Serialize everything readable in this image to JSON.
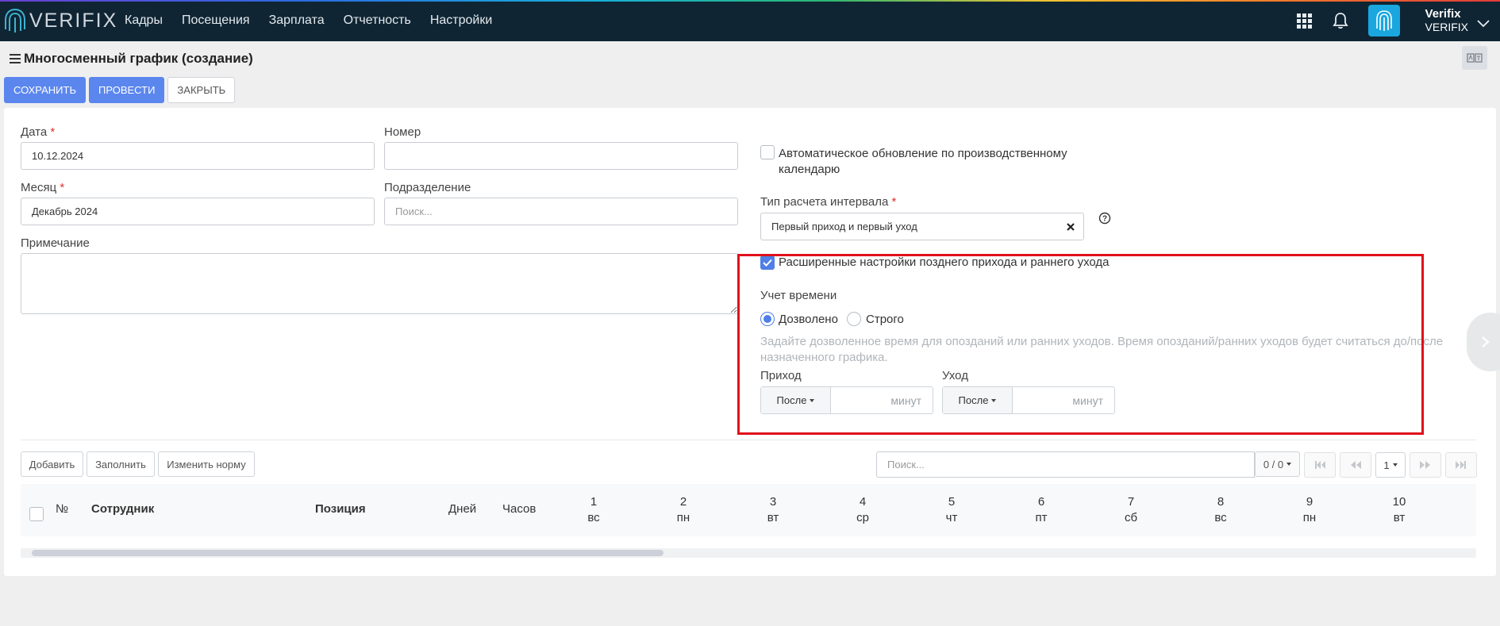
{
  "app": {
    "brand": "VERIFIX"
  },
  "nav": {
    "items": [
      "Кадры",
      "Посещения",
      "Зарплата",
      "Отчетность",
      "Настройки"
    ]
  },
  "user": {
    "name": "Verifix",
    "company": "VERIFIX"
  },
  "page": {
    "title": "Многосменный график (создание)"
  },
  "toolbar": {
    "save": "СОХРАНИТЬ",
    "post": "ПРОВЕСТИ",
    "close": "ЗАКРЫТЬ"
  },
  "form": {
    "date_label": "Дата",
    "date_value": "10.12.2024",
    "number_label": "Номер",
    "number_value": "",
    "month_label": "Месяц",
    "month_value": "Декабрь 2024",
    "division_label": "Подразделение",
    "division_placeholder": "Поиск...",
    "note_label": "Примечание",
    "required_mark": "*",
    "auto_update_line1": "Автоматическое обновление по производственному",
    "auto_update_line2": "календарю",
    "auto_update_checked": false,
    "interval_label": "Тип расчета интервала",
    "interval_value": "Первый приход и первый уход",
    "advanced_label": "Расширенные настройки позднего прихода и раннего ухода",
    "advanced_checked": true,
    "time_accounting_label": "Учет времени",
    "radio_allowed": "Дозволено",
    "radio_strict": "Строго",
    "selected_mode": "Дозволено",
    "hint_line1": "Задайте дозволенное время для опозданий или ранних уходов. Время опозданий/ранних уходов будет считаться до/после",
    "hint_line2": "назначенного графика.",
    "arrival_label": "Приход",
    "departure_label": "Уход",
    "after_option": "После",
    "minutes_unit": "минут"
  },
  "table_toolbar": {
    "add": "Добавить",
    "fill": "Заполнить",
    "change_norm": "Изменить норму",
    "search_placeholder": "Поиск...",
    "count": "0 / 0",
    "page": "1"
  },
  "table": {
    "columns": [
      "№",
      "Сотрудник",
      "Позиция",
      "Дней",
      "Часов"
    ],
    "days": [
      {
        "num": "1",
        "wd": "вс"
      },
      {
        "num": "2",
        "wd": "пн"
      },
      {
        "num": "3",
        "wd": "вт"
      },
      {
        "num": "4",
        "wd": "ср"
      },
      {
        "num": "5",
        "wd": "чт"
      },
      {
        "num": "6",
        "wd": "пт"
      },
      {
        "num": "7",
        "wd": "сб"
      },
      {
        "num": "8",
        "wd": "вс"
      },
      {
        "num": "9",
        "wd": "пн"
      },
      {
        "num": "10",
        "wd": "вт"
      }
    ]
  },
  "colors": {
    "topbar": "#0f2533",
    "accent": "#5b86ee",
    "highlight": "#e0101a"
  }
}
